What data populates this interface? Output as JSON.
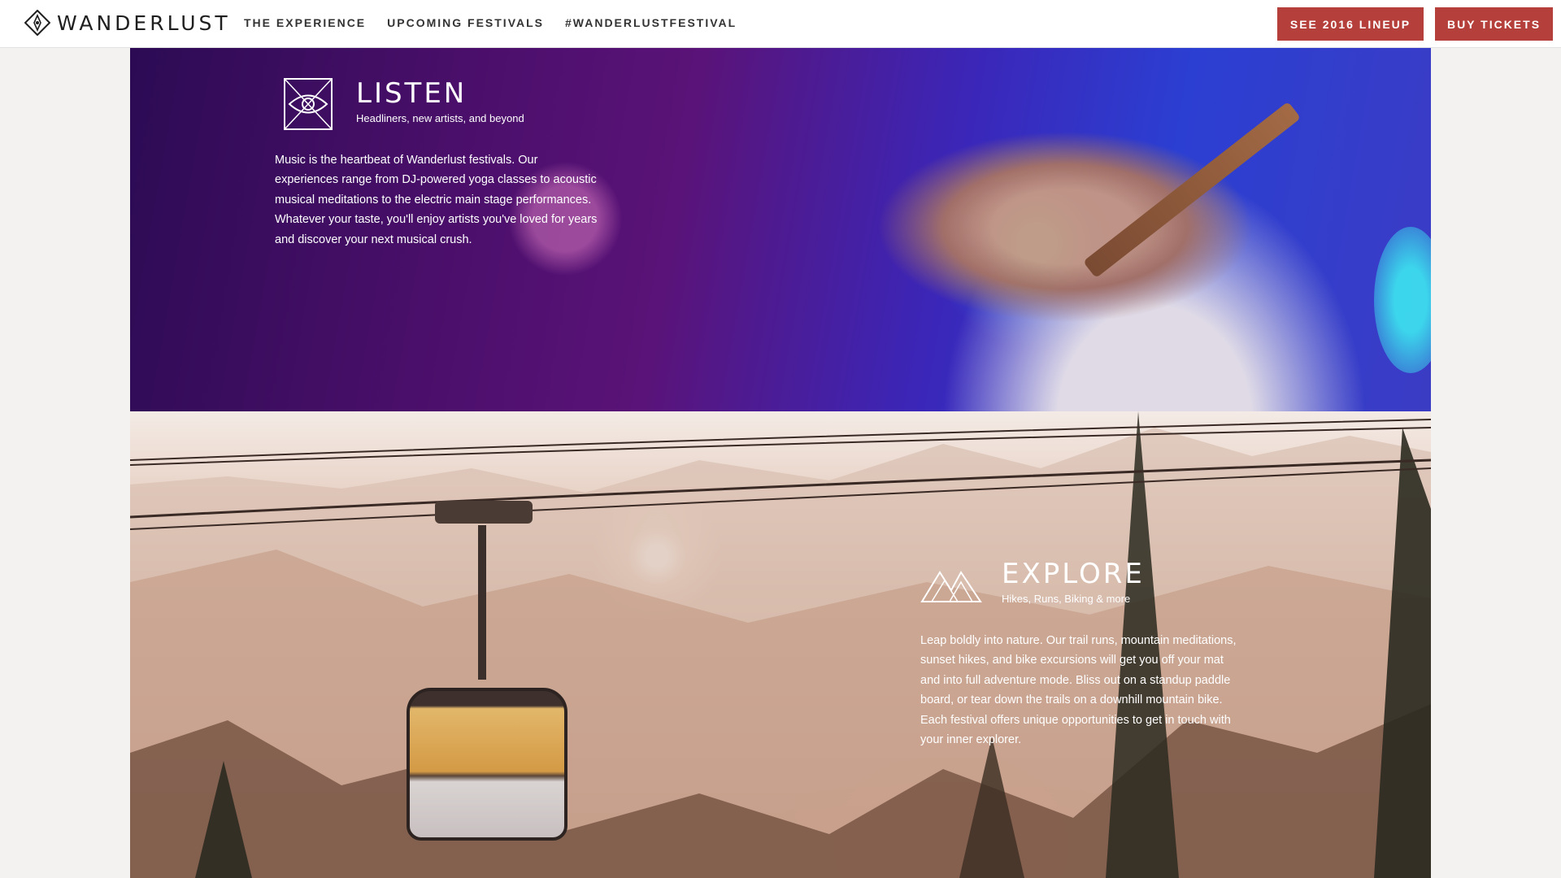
{
  "header": {
    "logo_text": "WANDERLUST",
    "logo_icon": "compass-diamond-icon",
    "nav": [
      {
        "label": "THE EXPERIENCE"
      },
      {
        "label": "UPCOMING FESTIVALS"
      },
      {
        "label": "#WANDERLUSTFESTIVAL"
      }
    ],
    "buttons": {
      "lineup": "SEE 2016 LINEUP",
      "tickets": "BUY TICKETS"
    },
    "accent_color": "#b53f3a"
  },
  "sections": {
    "listen": {
      "icon": "eye-hexagon-icon",
      "title": "LISTEN",
      "subtitle": "Headliners, new artists, and beyond",
      "body": "Music is the heartbeat of Wanderlust festivals. Our experiences range from DJ-powered yoga classes to acoustic musical meditations to the electric main stage performances. Whatever your taste, you'll enjoy artists you've loved for years and discover your next musical crush."
    },
    "explore": {
      "icon": "mountains-icon",
      "title": "EXPLORE",
      "subtitle": "Hikes, Runs, Biking & more",
      "body": "Leap boldly into nature. Our trail runs, mountain meditations, sunset hikes, and bike excursions will get you off your mat and into full adventure mode. Bliss out on a standup paddle board, or tear down the trails on a downhill mountain bike. Each festival offers unique opportunities to get in touch with your inner explorer."
    }
  }
}
